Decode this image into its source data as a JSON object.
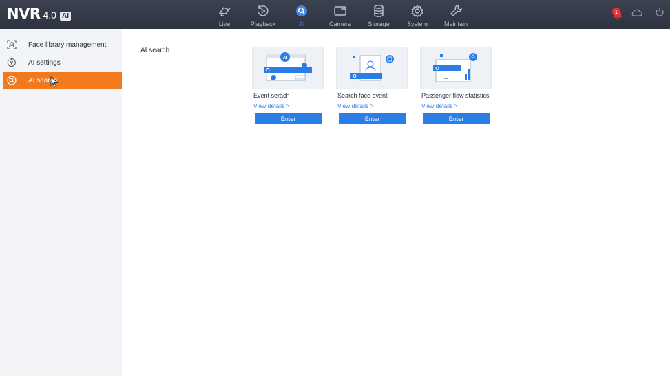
{
  "header": {
    "logo_main": "NVR",
    "logo_version": "4.0",
    "logo_badge": "AI",
    "nav": [
      {
        "label": "Live",
        "icon": "camera-icon"
      },
      {
        "label": "Playback",
        "icon": "playback-icon"
      },
      {
        "label": "AI",
        "icon": "ai-search-icon",
        "active": true
      },
      {
        "label": "Camera",
        "icon": "camera-screen-icon"
      },
      {
        "label": "Storage",
        "icon": "storage-icon"
      },
      {
        "label": "System",
        "icon": "gear-icon"
      },
      {
        "label": "Maintain",
        "icon": "wrench-icon"
      }
    ],
    "alarm_count": "1"
  },
  "sidebar": {
    "items": [
      {
        "label": "Face library management",
        "icon": "face-library-icon"
      },
      {
        "label": "AI settings",
        "icon": "ai-settings-icon"
      },
      {
        "label": "AI search",
        "icon": "ai-search-icon",
        "active": true
      }
    ]
  },
  "main": {
    "title": "AI search",
    "cards": [
      {
        "title": "Event serach",
        "details": "View details >",
        "button": "Enter"
      },
      {
        "title": "Search face event",
        "details": "View details >",
        "button": "Enter"
      },
      {
        "title": "Passenger flow statistics",
        "details": "View details >",
        "button": "Enter"
      }
    ]
  },
  "colors": {
    "topbar": "#2e3340",
    "accent_blue": "#2b7ee6",
    "active_orange": "#f07a1d",
    "alarm_red": "#e0323a"
  }
}
